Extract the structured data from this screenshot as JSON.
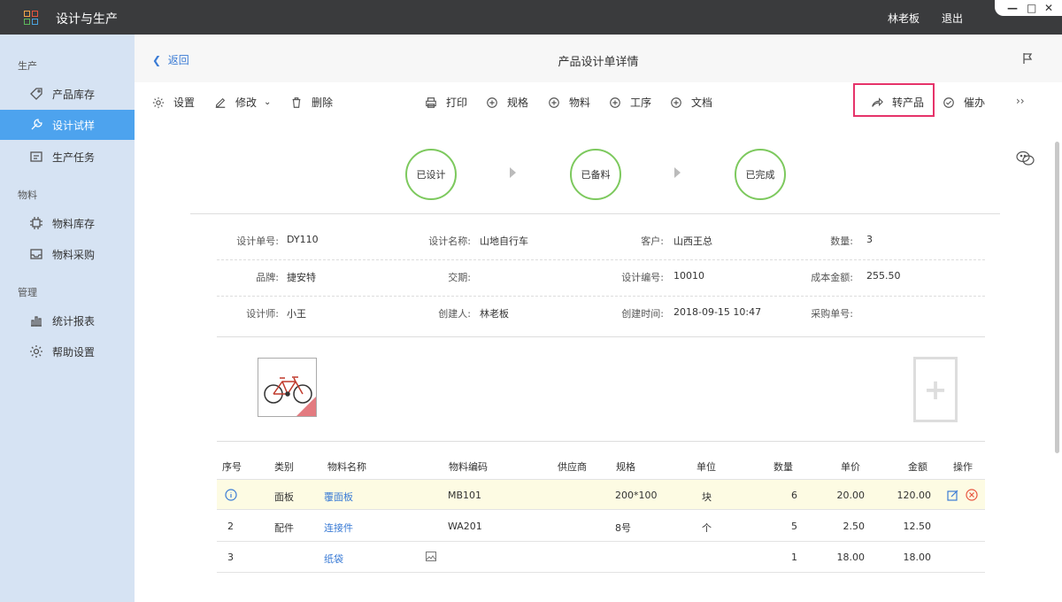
{
  "titlebar": {
    "app_title": "设计与生产",
    "user": "林老板",
    "logout": "退出"
  },
  "sidebar": {
    "groups": [
      "生产",
      "物料",
      "管理"
    ],
    "items": [
      {
        "label": "产品库存",
        "icon": "tag-icon"
      },
      {
        "label": "设计试样",
        "icon": "wrench-icon",
        "active": true
      },
      {
        "label": "生产任务",
        "icon": "task-icon"
      },
      {
        "label": "物料库存",
        "icon": "chip-icon"
      },
      {
        "label": "物料采购",
        "icon": "inbox-icon"
      },
      {
        "label": "统计报表",
        "icon": "bar-chart-icon"
      },
      {
        "label": "帮助设置",
        "icon": "gear-icon"
      }
    ]
  },
  "header": {
    "back": "返回",
    "title": "产品设计单详情"
  },
  "toolbar": {
    "settings": "设置",
    "edit": "修改",
    "delete": "删除",
    "print": "打印",
    "spec": "规格",
    "material": "物料",
    "process": "工序",
    "doc": "文档",
    "to_product": "转产品",
    "urge": "催办"
  },
  "steps": [
    "已设计",
    "已备料",
    "已完成"
  ],
  "info": {
    "design_no_label": "设计单号:",
    "design_no": "DY110",
    "design_name_label": "设计名称:",
    "design_name": "山地自行车",
    "customer_label": "客户:",
    "customer": "山西王总",
    "qty_label": "数量:",
    "qty": "3",
    "brand_label": "品牌:",
    "brand": "捷安特",
    "delivery_label": "交期:",
    "delivery": "",
    "design_code_label": "设计编号:",
    "design_code": "10010",
    "cost_label": "成本金额:",
    "cost": "255.50",
    "designer_label": "设计师:",
    "designer": "小王",
    "creator_label": "创建人:",
    "creator": "林老板",
    "created_label": "创建时间:",
    "created": "2018-09-15 10:47",
    "purchase_label": "采购单号:",
    "purchase": ""
  },
  "table": {
    "headers": [
      "序号",
      "类别",
      "物料名称",
      "物料编码",
      "供应商",
      "规格",
      "单位",
      "数量",
      "单价",
      "金额",
      "操作"
    ],
    "rows": [
      {
        "no": "",
        "cat": "面板",
        "name": "覆面板",
        "code": "MB101",
        "supplier": "",
        "spec": "200*100",
        "unit": "块",
        "qty": "6",
        "price": "20.00",
        "amount": "120.00"
      },
      {
        "no": "2",
        "cat": "配件",
        "name": "连接件",
        "code": "WA201",
        "supplier": "",
        "spec": "8号",
        "unit": "个",
        "qty": "5",
        "price": "2.50",
        "amount": "12.50"
      },
      {
        "no": "3",
        "cat": "",
        "name": "纸袋",
        "code": "",
        "supplier": "",
        "spec": "",
        "unit": "",
        "qty": "1",
        "price": "18.00",
        "amount": "18.00"
      }
    ]
  }
}
